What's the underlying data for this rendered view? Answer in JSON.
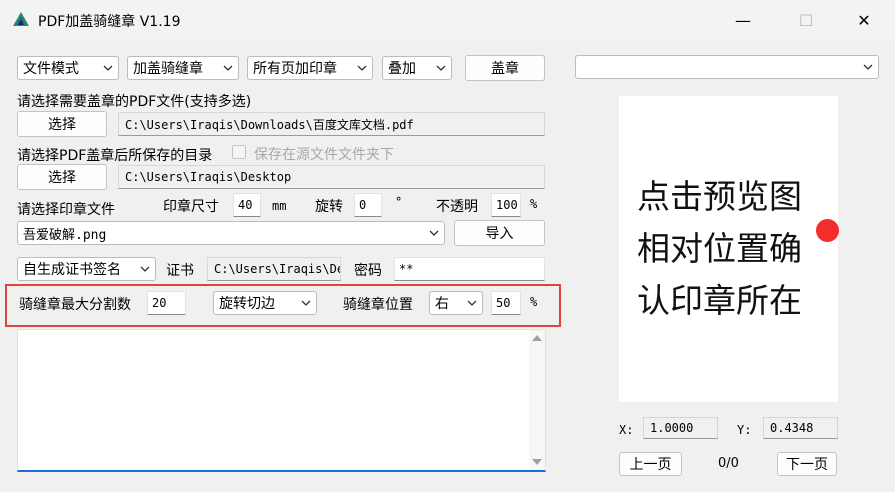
{
  "window": {
    "title": "PDF加盖骑缝章 V1.19",
    "minimize": "—",
    "maximize": "☐",
    "close": "✕"
  },
  "toolbar": {
    "mode": "文件模式",
    "stamp_type": "加盖骑缝章",
    "page_scope": "所有页加印章",
    "blend": "叠加",
    "apply_label": "盖章"
  },
  "pdf_files": {
    "label": "请选择需要盖章的PDF文件(支持多选)",
    "button": "选择",
    "path": "C:\\Users\\Iraqis\\Downloads\\百度文库文档.pdf"
  },
  "output_dir": {
    "label": "请选择PDF盖章后所保存的目录",
    "same_folder_checkbox": "保存在源文件文件夹下",
    "button": "选择",
    "path": "C:\\Users\\Iraqis\\Desktop"
  },
  "seal": {
    "label": "请选择印章文件",
    "size_label": "印章尺寸",
    "size_value": "40",
    "size_unit": "mm",
    "rotate_label": "旋转",
    "rotate_value": "0",
    "rotate_unit": "°",
    "opacity_label": "不透明",
    "opacity_value": "100",
    "opacity_unit": "%",
    "file": "吾爱破解.png",
    "import_label": "导入"
  },
  "cert": {
    "type": "自生成证书签名",
    "cert_label": "证书",
    "cert_path": "C:\\Users\\Iraqis\\De",
    "password_label": "密码",
    "password_value": "**"
  },
  "seam": {
    "max_split_label": "骑缝章最大分割数",
    "max_split_value": "20",
    "cut_mode": "旋转切边",
    "position_label": "骑缝章位置",
    "position_value": "右",
    "percent_value": "50",
    "percent_unit": "%"
  },
  "preview": {
    "dropdown_value": "",
    "hint": "点击预览图相对位置确认印章所在",
    "x_label": "X:",
    "x_value": "1.0000",
    "y_label": "Y:",
    "y_value": "0.4348",
    "prev_label": "上一页",
    "page_indicator": "0/0",
    "next_label": "下一页",
    "stamp_color": "#f42c2c"
  },
  "colors": {
    "highlight_border": "#e0443e",
    "log_focus_border": "#1a6fd1"
  }
}
